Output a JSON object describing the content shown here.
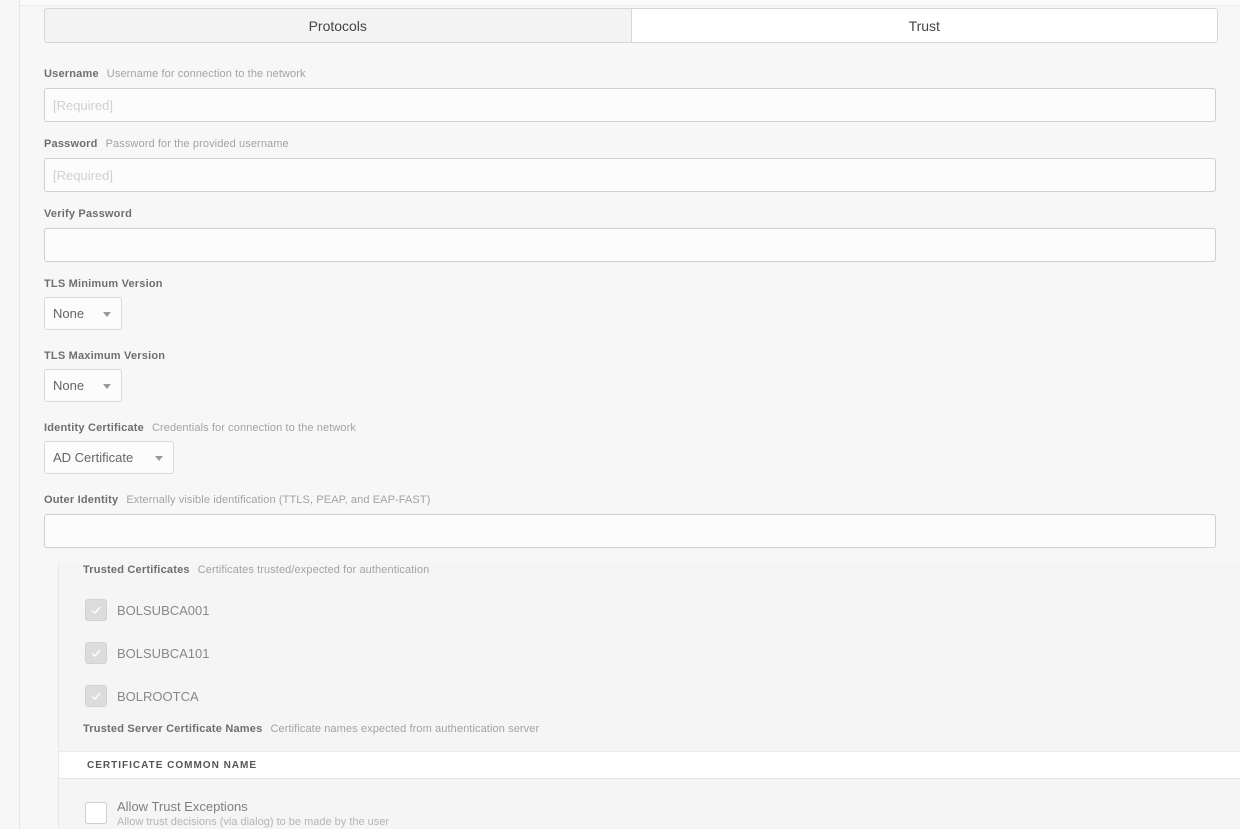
{
  "tabs": [
    {
      "label": "Protocols",
      "active": false
    },
    {
      "label": "Trust",
      "active": true
    }
  ],
  "username": {
    "label": "Username",
    "description": "Username for connection to the network",
    "placeholder": "[Required]",
    "value": ""
  },
  "password": {
    "label": "Password",
    "description": "Password for the provided username",
    "placeholder": "[Required]",
    "value": ""
  },
  "verify_password": {
    "label": "Verify Password",
    "value": ""
  },
  "tls_min": {
    "label": "TLS Minimum Version",
    "value": "None"
  },
  "tls_max": {
    "label": "TLS Maximum Version",
    "value": "None"
  },
  "identity_certificate": {
    "label": "Identity Certificate",
    "description": "Credentials for connection to the network",
    "value": "AD Certificate"
  },
  "outer_identity": {
    "label": "Outer Identity",
    "description": "Externally visible identification (TTLS, PEAP, and EAP-FAST)",
    "value": ""
  },
  "trusted_certificates": {
    "label": "Trusted Certificates",
    "description": "Certificates trusted/expected for authentication",
    "items": [
      {
        "name": "BOLSUBCA001",
        "checked": true
      },
      {
        "name": "BOLSUBCA101",
        "checked": true
      },
      {
        "name": "BOLROOTCA",
        "checked": true
      }
    ]
  },
  "trusted_server_names": {
    "label": "Trusted Server Certificate Names",
    "description": "Certificate names expected from authentication server",
    "column_header": "CERTIFICATE COMMON NAME"
  },
  "allow_trust_exceptions": {
    "label": "Allow Trust Exceptions",
    "description": "Allow trust decisions (via dialog) to be made by the user",
    "checked": false
  },
  "colors": {
    "background": "#f7f7f7",
    "label": "#6f6f6f",
    "description": "#a3a3a3",
    "border": "#cfcfcf"
  }
}
